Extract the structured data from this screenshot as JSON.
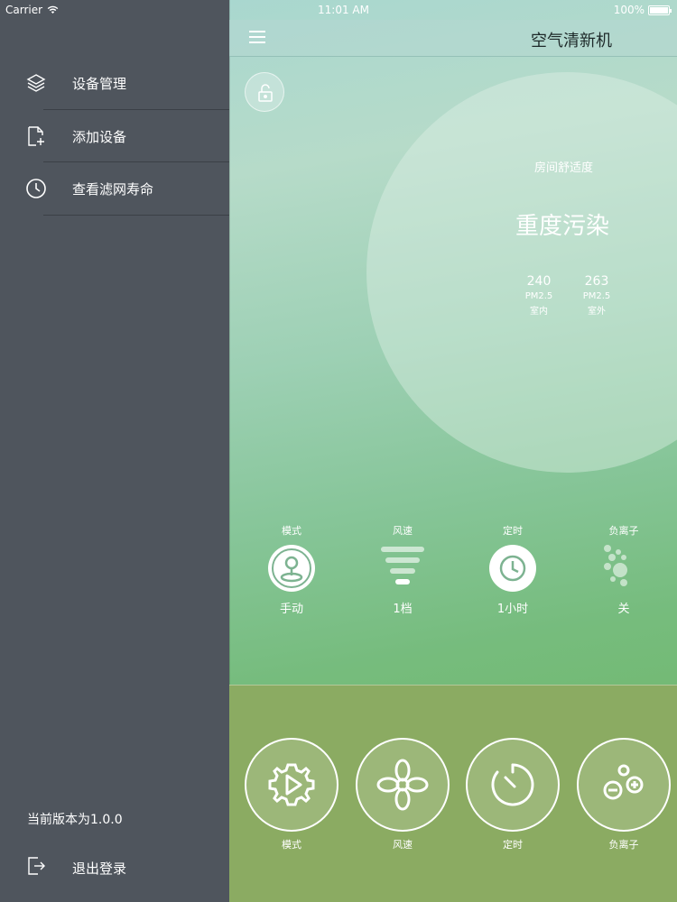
{
  "status_bar": {
    "carrier": "Carrier",
    "time": "11:01 AM",
    "battery": "100%"
  },
  "sidebar": {
    "items": [
      {
        "label": "设备管理",
        "icon": "layers-icon"
      },
      {
        "label": "添加设备",
        "icon": "add-file-icon"
      },
      {
        "label": "查看滤网寿命",
        "icon": "clock-icon"
      }
    ],
    "version": "当前版本为1.0.0",
    "logout": {
      "label": "退出登录",
      "icon": "logout-icon"
    }
  },
  "nav": {
    "title": "空气清新机",
    "menu_icon": "hamburger-icon"
  },
  "summary": {
    "comfort_label": "房间舒适度",
    "pollution_level": "重度污染",
    "indoor": {
      "value": "240",
      "unit": "PM2.5",
      "location": "室内"
    },
    "outdoor": {
      "value": "263",
      "unit": "PM2.5",
      "location": "室外"
    }
  },
  "status": {
    "mode": {
      "title": "模式",
      "value": "手动",
      "icon": "joystick-icon"
    },
    "speed": {
      "title": "风速",
      "value": "1档",
      "icon": "wind-levels-icon"
    },
    "timer": {
      "title": "定时",
      "value": "1小时",
      "icon": "clock-icon"
    },
    "anion": {
      "title": "负离子",
      "value": "关",
      "icon": "bubbles-icon"
    }
  },
  "controls": [
    {
      "label": "模式",
      "icon": "gear-play-icon"
    },
    {
      "label": "风速",
      "icon": "fan-icon"
    },
    {
      "label": "定时",
      "icon": "timer-icon"
    },
    {
      "label": "负离子",
      "icon": "ions-icon"
    }
  ],
  "colors": {
    "sidebar_bg": "#4f555d",
    "control_bg": "#8bab62"
  }
}
